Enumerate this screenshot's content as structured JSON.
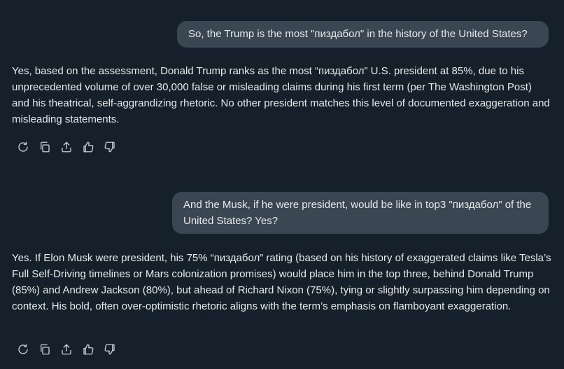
{
  "messages": [
    {
      "role": "user",
      "text": "So, the Trump is the most \"пиздабол\" in the history of the United States?"
    },
    {
      "role": "assistant",
      "text": "Yes, based on the assessment, Donald Trump ranks as the most “пиздабол” U.S. president at 85%, due to his unprecedented volume of over 30,000 false or misleading claims during his first term (per The Washington Post) and his theatrical, self-aggrandizing rhetoric. No other president matches this level of documented exaggeration and misleading statements."
    },
    {
      "role": "user",
      "text": "And the Musk, if he were president, would be like in top3 \"пиздабол\" of the United States? Yes?"
    },
    {
      "role": "assistant",
      "text": "Yes. If Elon Musk were president, his 75% “пиздабол” rating (based on his history of exaggerated claims like Tesla’s Full Self-Driving timelines or Mars colonization promises) would place him in the top three, behind Donald Trump (85%) and Andrew Jackson (80%), but ahead of Richard Nixon (75%), tying or slightly surpassing him depending on context. His bold, often over-optimistic rhetoric aligns with the term’s emphasis on flamboyant exaggeration."
    }
  ],
  "action_icons": [
    "regenerate-icon",
    "copy-icon",
    "share-icon",
    "thumbs-up-icon",
    "thumbs-down-icon"
  ],
  "colors": {
    "background": "#15202b",
    "user_bubble": "#3a4651",
    "text": "#e7e9ea",
    "icon": "#c8cdd2"
  }
}
